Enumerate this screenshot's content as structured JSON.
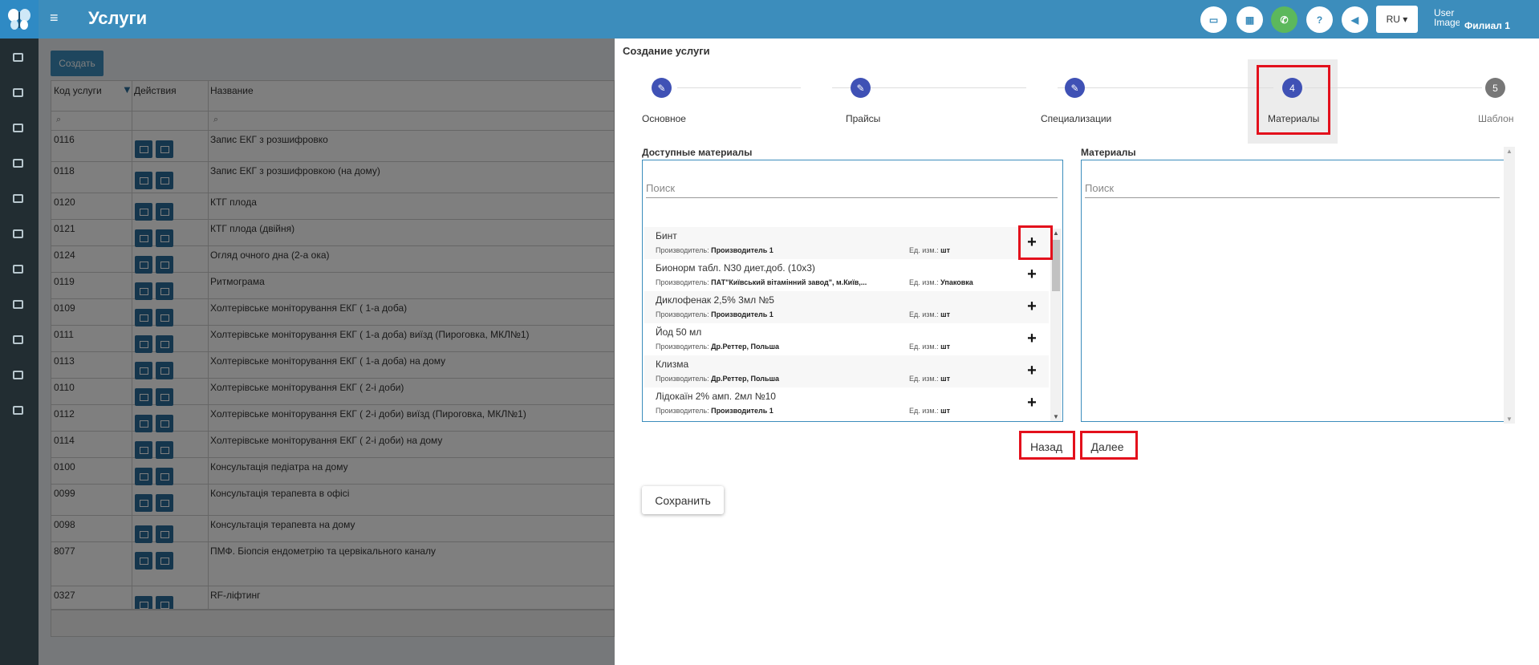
{
  "header": {
    "title": "Услуги",
    "lang": "RU ▾",
    "avatar_alt": "User Image",
    "branch": "Филиал 1",
    "icons": [
      "credit-card-icon",
      "calculator-icon",
      "phone-icon",
      "help-icon",
      "megaphone-icon"
    ]
  },
  "sidebar": {
    "icons": [
      "contact-icon",
      "flask-icon",
      "calendar-icon",
      "document-icon",
      "heartbeat-icon",
      "cubes-icon",
      "book-icon",
      "folder-icon",
      "money-icon",
      "settings-icon",
      "card-icon"
    ]
  },
  "services": {
    "create_label": "Создать",
    "columns": [
      "Код услуги",
      "Действия",
      "Название"
    ],
    "rows": [
      {
        "code": "0116",
        "name": "Запис ЕКГ з розшифровко"
      },
      {
        "code": "0118",
        "name": "Запис ЕКГ з розшифровкою (на дому)"
      },
      {
        "code": "0120",
        "name": "КТГ плода"
      },
      {
        "code": "0121",
        "name": "КТГ плода (двійня)"
      },
      {
        "code": "0124",
        "name": "Огляд очного дна (2-а ока)"
      },
      {
        "code": "0119",
        "name": "Ритмограма"
      },
      {
        "code": "0109",
        "name": "Холтерівське моніторування ЕКГ ( 1-а доба)"
      },
      {
        "code": "0111",
        "name": "Холтерівське моніторування ЕКГ ( 1-а доба) виїзд (Пироговка, МКЛ№1)"
      },
      {
        "code": "0113",
        "name": "Холтерівське моніторування ЕКГ ( 1-а доба) на дому"
      },
      {
        "code": "0110",
        "name": "Холтерівське моніторування ЕКГ ( 2-і доби)"
      },
      {
        "code": "0112",
        "name": "Холтерівське моніторування ЕКГ ( 2-і доби) виїзд (Пироговка, МКЛ№1)"
      },
      {
        "code": "0114",
        "name": "Холтерівське моніторування ЕКГ ( 2-і доби) на дому"
      },
      {
        "code": "0100",
        "name": "Консультація педіатра на дому"
      },
      {
        "code": "0099",
        "name": "Консультація терапевта в офісі"
      },
      {
        "code": "0098",
        "name": "Консультація терапевта на дому"
      },
      {
        "code": "8077",
        "name": "ПМФ. Біопсія ендометрію та цервікального каналу"
      },
      {
        "code": "0327",
        "name": "RF-ліфтинг"
      }
    ]
  },
  "panel": {
    "title": "Создание услуги",
    "steps": [
      {
        "num": "✎",
        "label": "Основное"
      },
      {
        "num": "✎",
        "label": "Прайсы"
      },
      {
        "num": "✎",
        "label": "Специализации"
      },
      {
        "num": "4",
        "label": "Материалы"
      },
      {
        "num": "5",
        "label": "Шаблон"
      }
    ],
    "available_label": "Доступные материалы",
    "selected_label": "Материалы",
    "search_placeholder": "Поиск",
    "manufacturer_label": "Производитель:",
    "unit_label": "Ед. изм.:",
    "materials": [
      {
        "name": "Бинт",
        "manufacturer": "Производитель 1",
        "unit": "шт"
      },
      {
        "name": "Бионорм табл. N30 диет.доб. (10х3)",
        "manufacturer": "ПАТ\"Київський вітамінний завод\", м.Київ,...",
        "unit": "Упаковка"
      },
      {
        "name": "Диклофенак 2,5% 3мл №5",
        "manufacturer": "Производитель 1",
        "unit": "шт"
      },
      {
        "name": "Йод 50 мл",
        "manufacturer": "Др.Реттер, Польша",
        "unit": "шт"
      },
      {
        "name": "Клизма",
        "manufacturer": "Др.Реттер, Польша",
        "unit": "шт"
      },
      {
        "name": "Лідокаїн 2% амп. 2мл №10",
        "manufacturer": "Производитель 1",
        "unit": "шт"
      }
    ],
    "back_label": "Назад",
    "next_label": "Далее",
    "save_label": "Сохранить"
  }
}
